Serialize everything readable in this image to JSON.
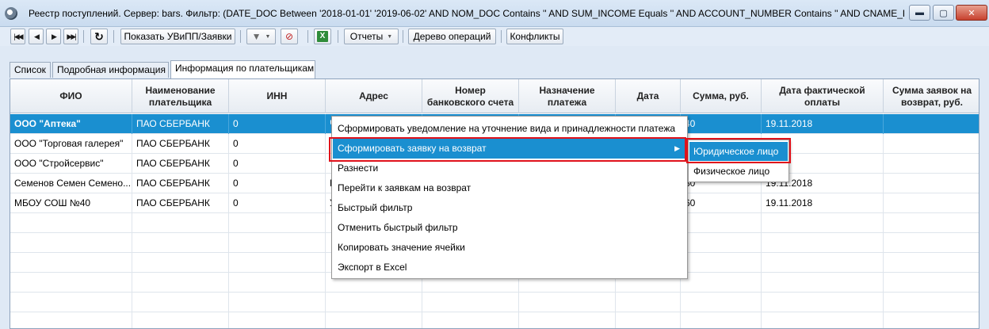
{
  "window": {
    "title": "Реестр поступлений. Сервер: bars. Фильтр: (DATE_DOC Between '2018-01-01' '2019-06-02' AND NOM_DOC Contains '' AND SUM_INCOME Equals '' AND ACCOUNT_NUMBER Contains '' AND CNAME_PAY Contains '')",
    "controls": {
      "minimize": "▬",
      "maximize": "▢",
      "close": "✕"
    }
  },
  "toolbar": {
    "nav_first": "|◀◀",
    "nav_prev": "◀",
    "nav_next": "▶",
    "nav_last": "▶▶|",
    "refresh": "↻",
    "show_button": "Показать УВиПП/Заявки",
    "filter_icon": "▼",
    "clear_filter_icon": "⊘",
    "excel_icon": "X",
    "reports": "Отчеты",
    "operations_tree": "Дерево операций",
    "conflicts": "Конфликты"
  },
  "tabs": [
    {
      "label": "Список",
      "active": false
    },
    {
      "label": "Подробная информация",
      "active": false
    },
    {
      "label": "Информация по плательщикам",
      "active": true
    }
  ],
  "grid": {
    "columns": [
      "ФИО",
      "Наименование плательщика",
      "ИНН",
      "Адрес",
      "Номер банковского счета",
      "Назначение платежа",
      "Дата",
      "Сумма, руб.",
      "Дата фактической оплаты",
      "Сумма заявок на возврат, руб."
    ],
    "rows": [
      {
        "fio": "ООО \"Аптека\"",
        "payer": "ПАО СБЕРБАНК",
        "inn": "0",
        "address": "Ч",
        "account": "",
        "purpose": "",
        "date": "",
        "sum": "40",
        "pay_date": "19.11.2018",
        "refund": "",
        "selected": true
      },
      {
        "fio": "ООО \"Торговая галерея\"",
        "payer": "ПАО СБЕРБАНК",
        "inn": "0",
        "address": "",
        "account": "",
        "purpose": "",
        "date": "",
        "sum": "",
        "pay_date": "18",
        "refund": "",
        "selected": false
      },
      {
        "fio": "ООО \"Стройсервис\"",
        "payer": "ПАО СБЕРБАНК",
        "inn": "0",
        "address": "",
        "account": "",
        "purpose": "",
        "date": "",
        "sum": "",
        "pay_date": "18",
        "refund": "",
        "selected": false
      },
      {
        "fio": "Семенов Семен Семено...",
        "payer": "ПАО СБЕРБАНК",
        "inn": "0",
        "address": "П",
        "account": "",
        "purpose": "",
        "date": "",
        "sum": "30",
        "pay_date": "19.11.2018",
        "refund": "",
        "selected": false
      },
      {
        "fio": "МБОУ СОШ №40",
        "payer": "ПАО СБЕРБАНК",
        "inn": "0",
        "address": "У",
        "account": "",
        "purpose": "",
        "date": "",
        "sum": "60",
        "pay_date": "19.11.2018",
        "refund": "",
        "selected": false
      }
    ]
  },
  "context_menu": {
    "items": [
      {
        "label": "Сформировать уведомление на уточнение вида и принадлежности платежа",
        "has_submenu": false,
        "highlighted": false
      },
      {
        "label": "Сформировать заявку на возврат",
        "has_submenu": true,
        "highlighted": true
      },
      {
        "label": "Разнести",
        "has_submenu": false,
        "highlighted": false
      },
      {
        "label": "Перейти к заявкам на возврат",
        "has_submenu": false,
        "highlighted": false
      },
      {
        "label": "Быстрый фильтр",
        "has_submenu": false,
        "highlighted": false
      },
      {
        "label": "Отменить быстрый фильтр",
        "has_submenu": false,
        "highlighted": false
      },
      {
        "label": "Копировать значение ячейки",
        "has_submenu": false,
        "highlighted": false
      },
      {
        "label": "Экспорт в Excel",
        "has_submenu": false,
        "highlighted": false
      }
    ],
    "submenu_arrow": "▶"
  },
  "submenu": {
    "items": [
      {
        "label": "Юридическое лицо",
        "highlighted": true
      },
      {
        "label": "Физическое лицо",
        "highlighted": false
      }
    ]
  },
  "colors": {
    "selection": "#1a8fd0",
    "annotation": "#e0121b"
  }
}
